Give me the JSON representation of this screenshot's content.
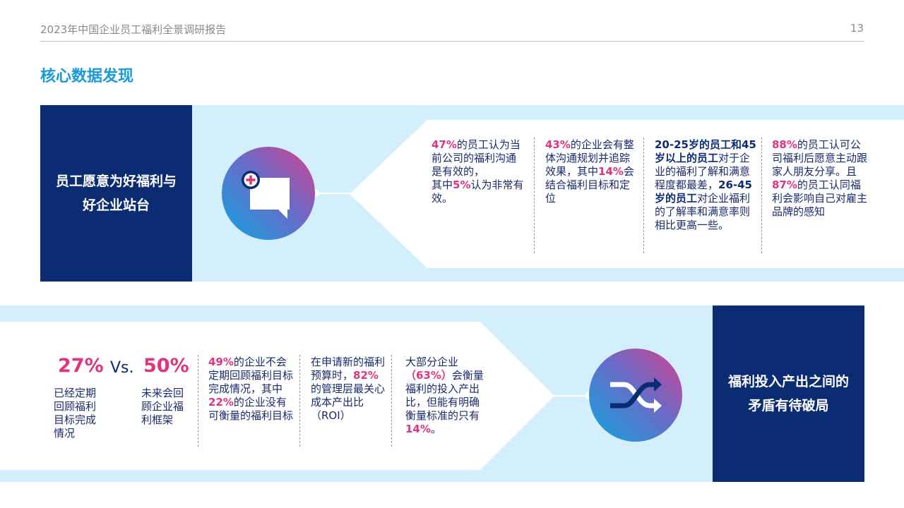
{
  "header": {
    "title": "2023年中国企业员工福利全景调研报告",
    "page_number": "13"
  },
  "section_title": "核心数据发现",
  "colors": {
    "accent_blue": "#1a9ad6",
    "navy": "#0b2c73",
    "pink": "#e0347f",
    "band": "#d3effb"
  },
  "top_block": {
    "label_line1": "员工愿意为好福利与",
    "label_line2": "好企业站台",
    "icon": "chat-plus-icon",
    "items": [
      {
        "segments": [
          {
            "text": "47%",
            "style": "pink"
          },
          {
            "text": "的员工认为当前公司的福利沟通是有效的，",
            "style": "normal"
          },
          {
            "text": "\n其中",
            "style": "normal"
          },
          {
            "text": "5%",
            "style": "pink"
          },
          {
            "text": "认为非常有效。",
            "style": "normal"
          }
        ]
      },
      {
        "segments": [
          {
            "text": "43%",
            "style": "pink"
          },
          {
            "text": "的企业会有整体沟通规划并追踪效果，其中",
            "style": "normal"
          },
          {
            "text": "14%",
            "style": "pink"
          },
          {
            "text": "会结合福利目标和定位",
            "style": "normal"
          }
        ]
      },
      {
        "segments": [
          {
            "text": "20-25岁的员工和45岁以上的员工",
            "style": "navy-bold"
          },
          {
            "text": "对于企业的福利了解和满意程度都最差，",
            "style": "normal"
          },
          {
            "text": "26-45岁的员工",
            "style": "navy-bold"
          },
          {
            "text": "对企业福利的了解率和满意率则相比更高一些。",
            "style": "normal"
          }
        ]
      },
      {
        "segments": [
          {
            "text": "88%",
            "style": "pink"
          },
          {
            "text": "的员工认可公司福利后愿意主动跟家人朋友分享。且",
            "style": "normal"
          },
          {
            "text": "87%",
            "style": "pink"
          },
          {
            "text": "的员工认同福利会影响自己对雇主品牌的感知",
            "style": "normal"
          }
        ]
      }
    ]
  },
  "bottom_block": {
    "label_line1": "福利投入产出之间的",
    "label_line2": "矛盾有待破局",
    "icon": "shuffle-icon",
    "stat_left": {
      "value": "27%",
      "caption": "已经定期回顾福利目标完成情况"
    },
    "vs_label": "Vs.",
    "stat_right": {
      "value": "50%",
      "caption": "未来会回顾企业福利框架"
    },
    "items": [
      {
        "segments": [
          {
            "text": "49%",
            "style": "pink"
          },
          {
            "text": "的企业不会定期回顾福利目标完成情况，其中",
            "style": "normal"
          },
          {
            "text": "22%",
            "style": "pink"
          },
          {
            "text": "的企业没有可衡量的福利目标",
            "style": "normal"
          }
        ]
      },
      {
        "segments": [
          {
            "text": "在申请新的福利预算时，",
            "style": "normal"
          },
          {
            "text": "82%",
            "style": "pink"
          },
          {
            "text": "的管理层最关心成本产出比（ROI）",
            "style": "normal"
          }
        ]
      },
      {
        "segments": [
          {
            "text": "大部分企业",
            "style": "normal"
          },
          {
            "text": "（63%）",
            "style": "pink"
          },
          {
            "text": "会衡量福利的投入产出比，但能有明确衡量标准的只有",
            "style": "normal"
          },
          {
            "text": "14%",
            "style": "pink"
          },
          {
            "text": "。",
            "style": "normal"
          }
        ]
      }
    ]
  }
}
